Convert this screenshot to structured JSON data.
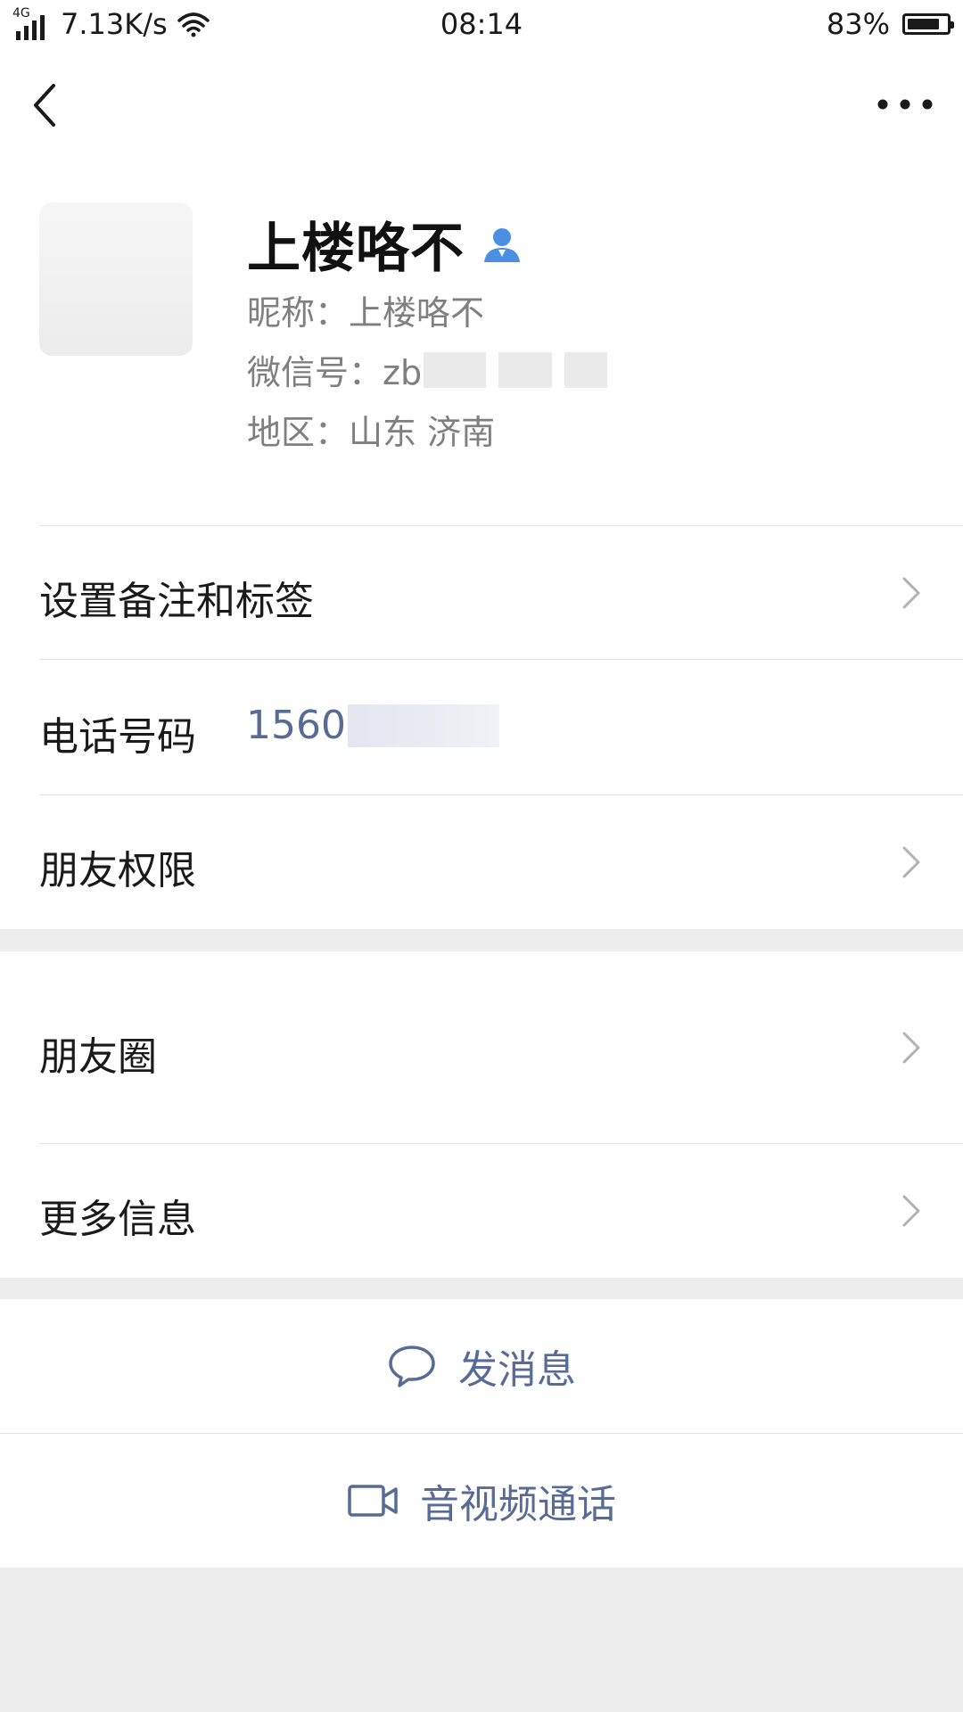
{
  "status_bar": {
    "network_type": "4G",
    "speed": "7.13K/s",
    "time": "08:14",
    "battery_percent": "83%",
    "battery_level": 0.83,
    "icons": [
      "signal-icon",
      "wifi-icon",
      "battery-icon"
    ]
  },
  "nav": {
    "back_icon": "back-chevron-icon",
    "more_icon": "more-dots-icon"
  },
  "profile": {
    "display_name": "上楼咯不",
    "nickname_line": "昵称：上楼咯不",
    "wechat_id_prefix": "微信号：zb",
    "region_line": "地区：山东  济南",
    "contact_icon": "contact-person-icon",
    "contact_icon_color": "#4a8fe2"
  },
  "menu": {
    "remark_tags": "设置备注和标签",
    "phone_label": "电话号码",
    "phone_value_prefix": "1560",
    "friend_permissions": "朋友权限",
    "moments": "朋友圈",
    "more_info": "更多信息"
  },
  "actions": {
    "send_message": "发消息",
    "video_call": "音视频通话",
    "send_message_icon": "chat-bubble-icon",
    "video_call_icon": "video-camera-icon"
  },
  "colors": {
    "link_blue": "#576b95",
    "background": "#ededed",
    "card": "#ffffff"
  }
}
